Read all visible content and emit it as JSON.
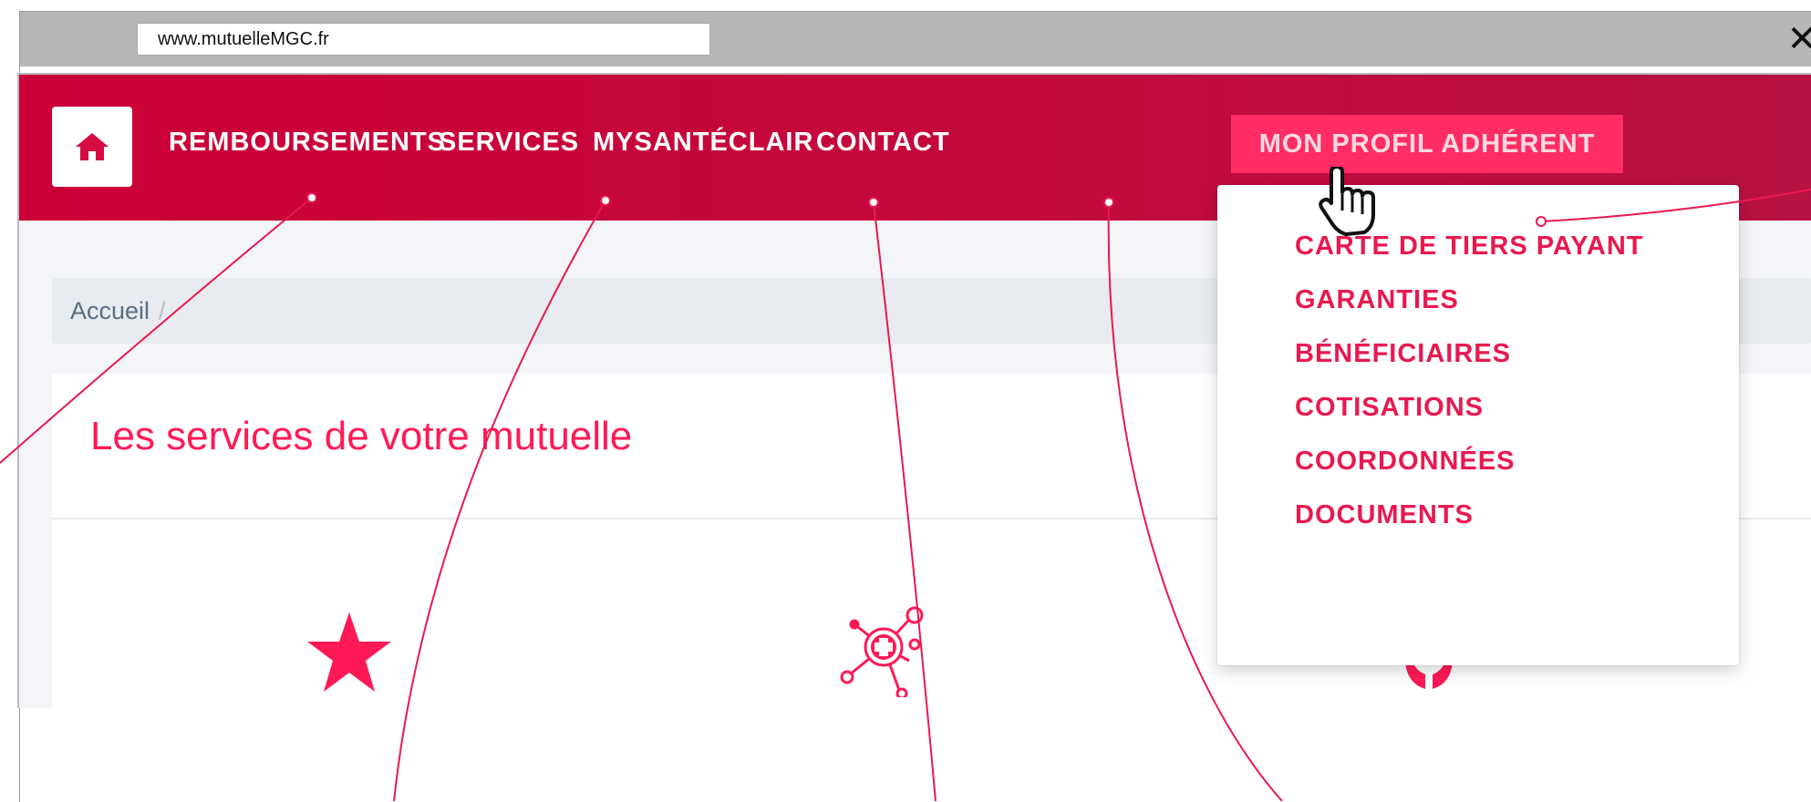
{
  "browser": {
    "url": "www.mutuelleMGC.fr",
    "close_glyph": "✕"
  },
  "navbar": {
    "home_icon": "home-icon",
    "items": [
      {
        "label": "REMBOURSEMENTS"
      },
      {
        "label": "SERVICES"
      },
      {
        "label": "MYSANTÉCLAIR"
      },
      {
        "label": "CONTACT"
      }
    ],
    "active_item": {
      "label": "MON PROFIL ADHÉRENT"
    },
    "brand_color": "#cc0038",
    "active_color": "#ff2d64"
  },
  "breadcrumb": {
    "home": "Accueil",
    "separator": "/"
  },
  "main": {
    "title": "Les services de votre mutuelle",
    "icons": [
      "star-icon",
      "health-network-icon",
      "care-hands-icon"
    ]
  },
  "dropdown": {
    "items": [
      {
        "label": "CARTE DE TIERS PAYANT"
      },
      {
        "label": "GARANTIES"
      },
      {
        "label": "BÉNÉFICIAIRES"
      },
      {
        "label": "COTISATIONS"
      },
      {
        "label": "COORDONNÉES"
      },
      {
        "label": "DOCUMENTS"
      }
    ]
  },
  "annotation_color": "#e8194f"
}
